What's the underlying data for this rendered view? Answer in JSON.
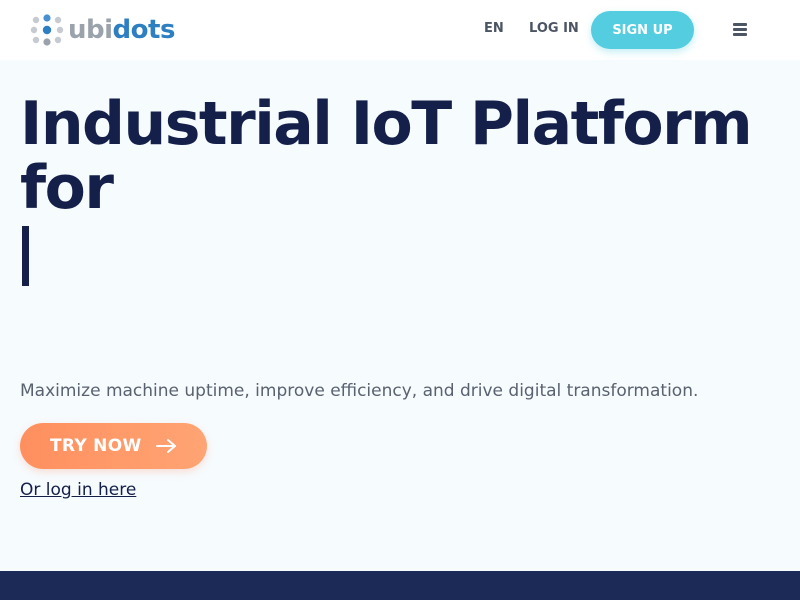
{
  "header": {
    "logo": {
      "text_part1": "ubi",
      "text_part2": "dots",
      "icon": "ubidots-dots-logo-icon"
    },
    "language_label": "EN",
    "login_label": "LOG IN",
    "signup_label": "SIGN UP",
    "menu_icon": "hamburger-menu-icon"
  },
  "hero": {
    "title": "Industrial IoT Platform for",
    "subtitle": "Maximize machine uptime, improve efficiency, and drive digital transformation.",
    "try_button_label": "TRY NOW",
    "try_button_icon": "arrow-right-icon",
    "login_link": "Or log in here"
  },
  "colors": {
    "primary_dark": "#14204a",
    "signup_accent": "#53cddf",
    "try_accent": "#ff8f5e",
    "logo_grey": "#9aa2ab",
    "logo_blue": "#2d7fc1",
    "footer_band": "#1b2a56",
    "page_background": "#f6fbfe"
  }
}
